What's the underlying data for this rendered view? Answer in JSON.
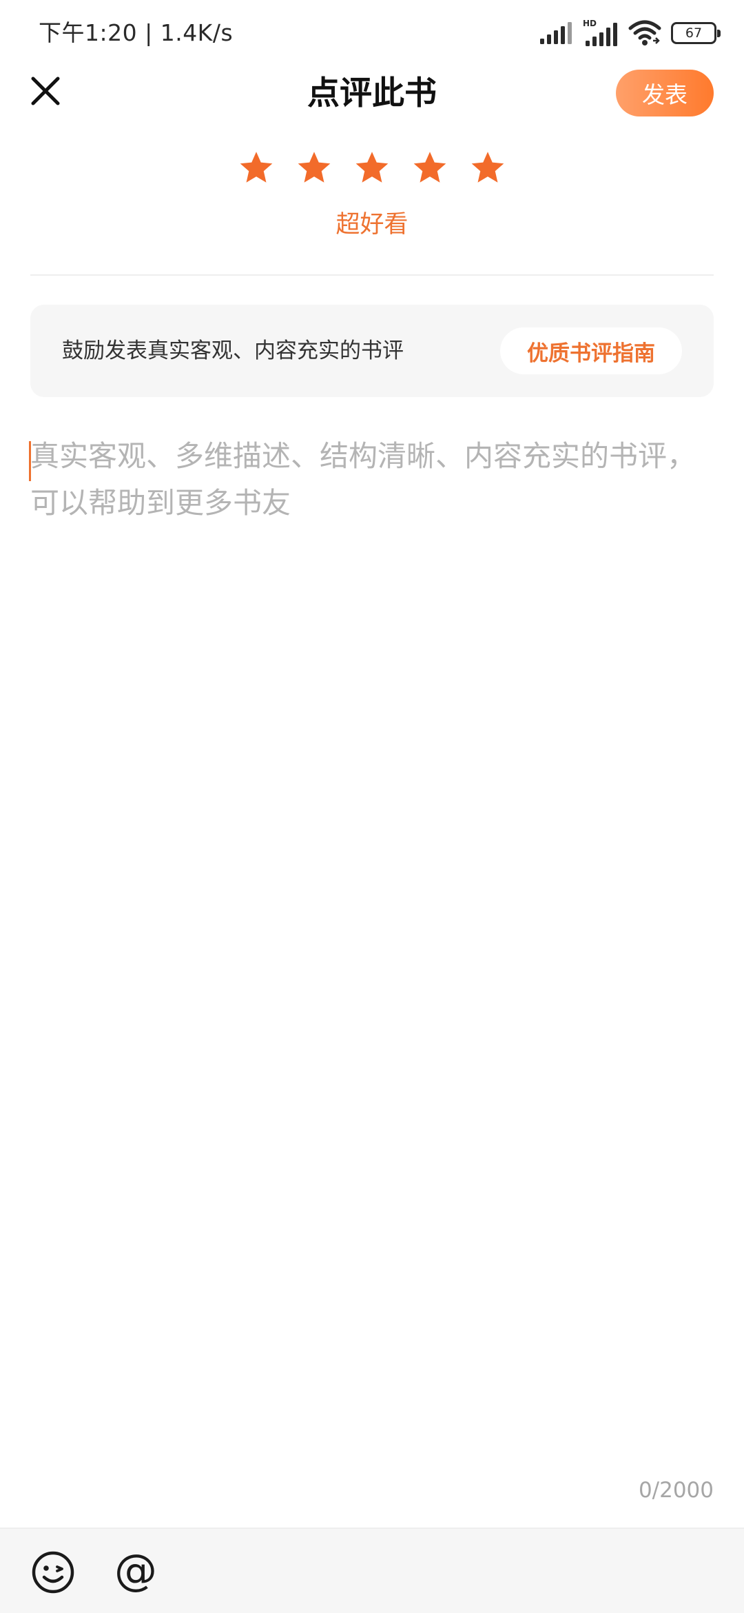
{
  "status_bar": {
    "time_speed": "下午1:20 | 1.4K/s",
    "hd_label": "HD",
    "battery": "67"
  },
  "header": {
    "title": "点评此书",
    "publish_label": "发表"
  },
  "rating": {
    "stars": 5,
    "max_stars": 5,
    "label": "超好看",
    "star_color": "#f26b2a"
  },
  "tips": {
    "text": "鼓励发表真实客观、内容充实的书评",
    "guide_label": "优质书评指南"
  },
  "editor": {
    "value": "",
    "placeholder": "真实客观、多维描述、结构清晰、内容充实的书评，可以帮助到更多书友",
    "char_count": "0/2000"
  },
  "toolbar": {
    "emoji_icon": "emoji-icon",
    "at_label": "@"
  },
  "colors": {
    "accent": "#ee7230",
    "publish_gradient_start": "#ffa06a",
    "publish_gradient_end": "#ff7a2d"
  }
}
